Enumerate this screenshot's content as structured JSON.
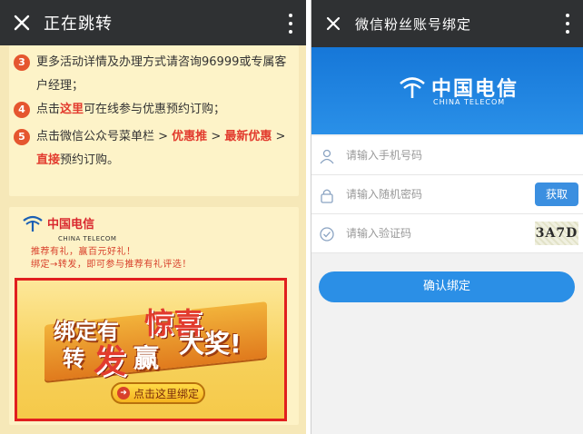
{
  "left": {
    "header": {
      "title": "正在跳转"
    },
    "steps": [
      {
        "num": "3",
        "parts": [
          "更多活动详情及办理方式请咨询96999或专属客户经理；"
        ]
      },
      {
        "num": "4",
        "pre": "点击",
        "link": "这里",
        "post": "可在线参与优惠预约订购；"
      },
      {
        "num": "5",
        "pre": "点击微信公众号菜单栏 > ",
        "link1": "优惠推",
        "mid": " > ",
        "link2": "最新优惠",
        "mid2": " > ",
        "link3": "直接",
        "post": "预约订购。"
      }
    ],
    "promo": {
      "logo_cn": "中国电信",
      "logo_en": "CHINA TELECOM",
      "slogan1": "推荐有礼，赢百元好礼！",
      "slogan2": "绑定→转发，即可参与推荐有礼评选！",
      "headline1": "绑定有",
      "headline2": "惊喜",
      "headline3": "转",
      "headline4": "发",
      "headline5": "赢",
      "headline6": "大奖!",
      "cta": "点击这里绑定"
    }
  },
  "right": {
    "header": {
      "title": "微信粉丝账号绑定"
    },
    "logo_cn": "中国电信",
    "logo_en": "CHINA TELECOM",
    "fields": [
      {
        "placeholder": "请输入手机号码",
        "icon": "user-icon"
      },
      {
        "placeholder": "请输入随机密码",
        "icon": "lock-icon",
        "button": "获取"
      },
      {
        "placeholder": "请输入验证码",
        "icon": "check-icon",
        "captcha": "3A7D"
      }
    ],
    "confirm": "确认绑定"
  },
  "colors": {
    "topbar": "#2f3133",
    "accent_blue": "#2b8fe6",
    "promo_red": "#e11f1f",
    "cream": "#fdf3c8"
  }
}
